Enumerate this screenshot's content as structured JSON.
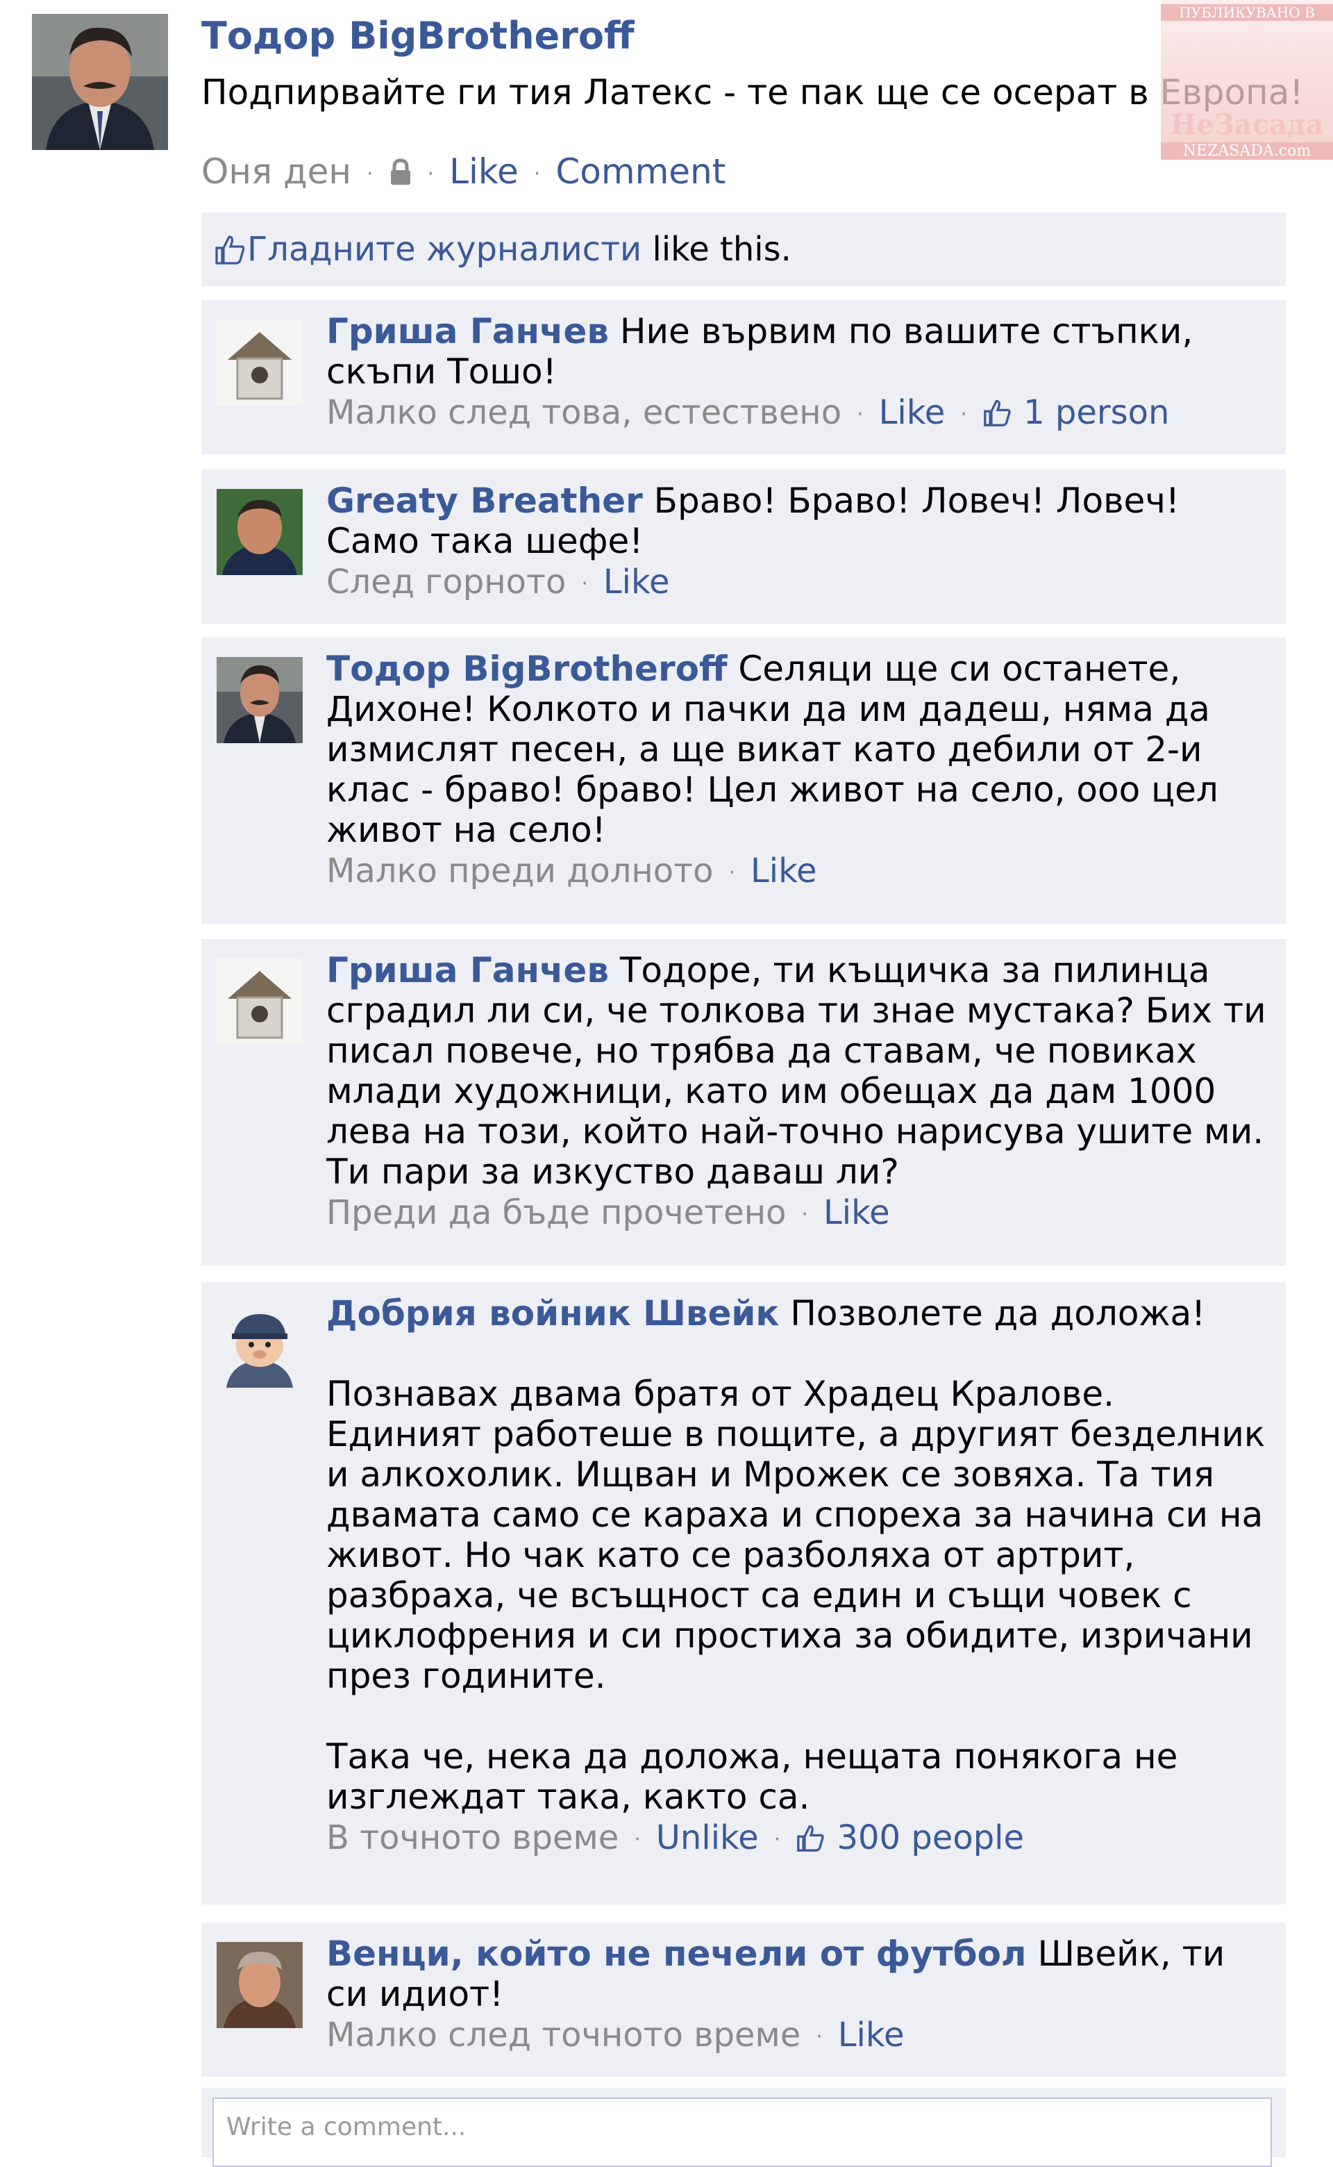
{
  "post": {
    "author": "Тодор BigBrotheroff",
    "text": "Подпирвайте ги тия Латекс - те пак ще се осерат в Европа!",
    "time": "Оня ден",
    "like": "Like",
    "comment": "Comment"
  },
  "watermark": {
    "top": "ПУБЛИКУВАНО В",
    "name": "НеЗасада",
    "url": "NEZASADA.com"
  },
  "likes": {
    "names": "Гладните журналисти",
    "suffix": " like this."
  },
  "comments": [
    {
      "author": "Гриша Ганчев",
      "text": "Ние вървим по вашите стъпки, скъпи Тошо!",
      "time": "Малко след това, естествено",
      "action": "Like",
      "likes": "1 person"
    },
    {
      "author": "Greaty Breather",
      "text": "Браво! Браво! Ловеч! Ловеч! Само така шефе!",
      "time": "След горното",
      "action": "Like"
    },
    {
      "author": "Тодор BigBrotheroff",
      "text": "Селяци ще си останете, Дихоне! Колкото и пачки да им дадеш, няма да измислят песен, а ще викат като дебили от 2-и клас - браво! браво! Цел живот на село, ооо цел живот на село!",
      "time": "Малко преди долното",
      "action": "Like"
    },
    {
      "author": "Гриша Ганчев",
      "text": "Тодоре, ти къщичка за пилинца сградил ли си, че толкова ти знае мустака? Бих ти писал повече, но трябва да ставам, че повиках млади художници, като им обещах да дам 1000 лева на този, който най-точно нарисува ушите ми. Ти пари за изкуство даваш ли?",
      "time": "Преди да бъде прочетено",
      "action": "Like"
    },
    {
      "author": "Добрия войник Швейк",
      "text": "Позволете да доложа!",
      "paragraph2": "Познавах двама братя от Храдец Кралове. Единият работеше в пощите, а другият безделник и алкохолик. Ищван и Мрожек се зовяха. Та тия двамата само се караха и спореха за начина си на живот. Но чак като се разболяха от артрит, разбраха, че всъщност са един и същи човек с циклофрения и си простиха за обидите, изричани през годините.",
      "paragraph3": "Така че, нека да доложа, нещата понякога не изглеждат така, както са.",
      "time": "В точното време",
      "action": "Unlike",
      "likes": "300 people"
    },
    {
      "author": "Венци, който не печели от футбол",
      "text": "Швейк, ти си идиот!",
      "time": "Малко след точното време",
      "action": "Like"
    }
  ],
  "comment_box": {
    "placeholder": "Write a comment..."
  },
  "colors": {
    "link": "#3b5998",
    "panel": "#edeff4",
    "meta": "#8a8a8a"
  }
}
